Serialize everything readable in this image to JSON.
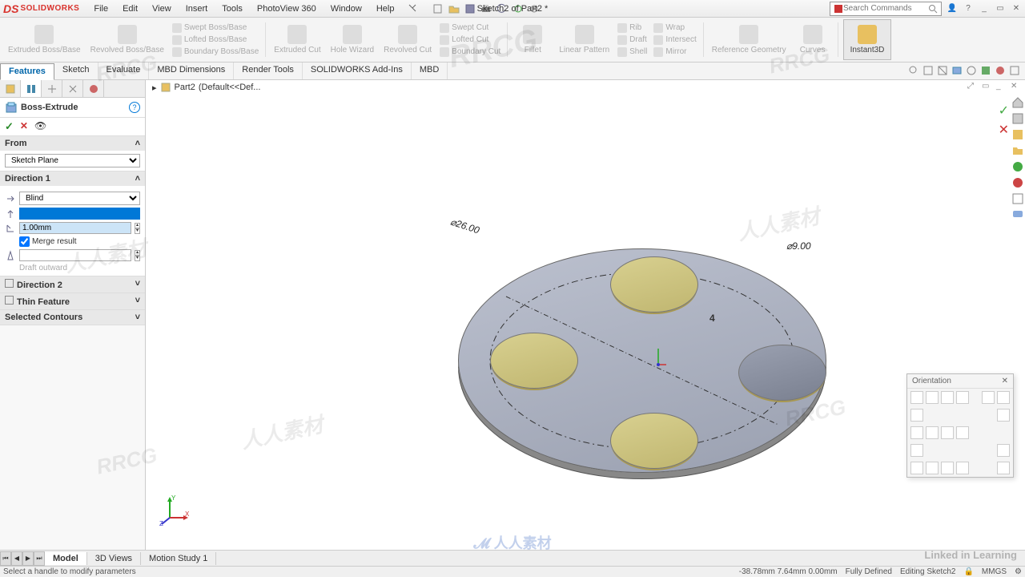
{
  "app": {
    "brand_prefix": "DS",
    "brand": "SOLIDWORKS",
    "doc_title": "Sketch2 of Part2 *"
  },
  "menu": [
    "File",
    "Edit",
    "View",
    "Insert",
    "Tools",
    "PhotoView 360",
    "Window",
    "Help"
  ],
  "search": {
    "placeholder": "Search Commands"
  },
  "ribbon": {
    "big": [
      {
        "label": "Extruded Boss/Base"
      },
      {
        "label": "Revolved Boss/Base"
      }
    ],
    "boss_list": [
      "Swept Boss/Base",
      "Lofted Boss/Base",
      "Boundary Boss/Base"
    ],
    "mid": [
      {
        "label": "Extruded Cut"
      },
      {
        "label": "Hole Wizard"
      },
      {
        "label": "Revolved Cut"
      }
    ],
    "cut_list": [
      "Swept Cut",
      "Lofted Cut",
      "Boundary Cut"
    ],
    "tools": [
      "Fillet",
      "Linear Pattern"
    ],
    "tools2": [
      "Rib",
      "Draft",
      "Shell"
    ],
    "tools3": [
      "Wrap",
      "Intersect",
      "Mirror"
    ],
    "ref": [
      "Reference Geometry",
      "Curves"
    ],
    "instant3d": "Instant3D"
  },
  "feature_tabs": [
    "Features",
    "Sketch",
    "Evaluate",
    "MBD Dimensions",
    "Render Tools",
    "SOLIDWORKS Add-Ins",
    "MBD"
  ],
  "breadcrumb": {
    "part": "Part2",
    "config": "(Default<<Def..."
  },
  "pm": {
    "title": "Boss-Extrude",
    "from": {
      "label": "From",
      "value": "Sketch Plane"
    },
    "dir1": {
      "label": "Direction 1",
      "end": "Blind",
      "depth": "1.00mm",
      "merge": "Merge result",
      "draft": "Draft outward"
    },
    "dir2": "Direction 2",
    "thin": "Thin Feature",
    "selcont": "Selected Contours"
  },
  "dims": {
    "d1": "⌀26.00",
    "d2": "⌀9.00",
    "count": "4"
  },
  "orient": {
    "title": "Orientation"
  },
  "bottom_tabs": [
    "Model",
    "3D Views",
    "Motion Study 1"
  ],
  "status": {
    "hint": "Select a handle to modify parameters",
    "coords": "-38.78mm    7.64mm   0.00mm",
    "state": "Fully Defined",
    "mode": "Editing Sketch2",
    "units": "MMGS"
  },
  "linkedin": "Linked in Learning"
}
